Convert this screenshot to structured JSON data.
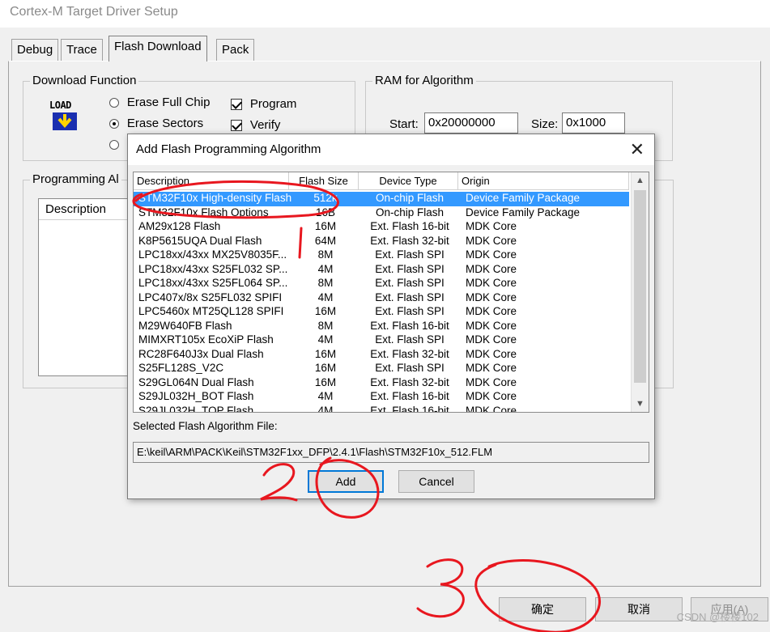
{
  "window": {
    "title": "Cortex-M Target Driver Setup"
  },
  "tabs": [
    {
      "label": "Debug",
      "active": false
    },
    {
      "label": "Trace",
      "active": false
    },
    {
      "label": "Flash Download",
      "active": true
    },
    {
      "label": "Pack",
      "active": false
    }
  ],
  "download_function": {
    "label": "Download Function",
    "icon_label": "LOAD",
    "radio_erase_full_chip": "Erase Full Chip",
    "radio_erase_sectors": "Erase Sectors",
    "check_program": "Program",
    "check_verify": "Verify"
  },
  "ram": {
    "label": "RAM for Algorithm",
    "start_label": "Start:",
    "start_value": "0x20000000",
    "size_label": "Size:",
    "size_value": "0x1000"
  },
  "programming": {
    "label": "Programming Al",
    "description_header": "Description"
  },
  "dialog": {
    "title": "Add Flash Programming Algorithm",
    "close_symbol": "✕",
    "columns": [
      "Description",
      "Flash Size",
      "Device Type",
      "Origin"
    ],
    "rows": [
      [
        "STM32F10x High-density Flash",
        "512k",
        "On-chip Flash",
        "Device Family Package"
      ],
      [
        "STM32F10x Flash Options",
        "16B",
        "On-chip Flash",
        "Device Family Package"
      ],
      [
        "AM29x128 Flash",
        "16M",
        "Ext. Flash 16-bit",
        "MDK Core"
      ],
      [
        "K8P5615UQA Dual Flash",
        "64M",
        "Ext. Flash 32-bit",
        "MDK Core"
      ],
      [
        "LPC18xx/43xx MX25V8035F...",
        "8M",
        "Ext. Flash SPI",
        "MDK Core"
      ],
      [
        "LPC18xx/43xx S25FL032 SP...",
        "4M",
        "Ext. Flash SPI",
        "MDK Core"
      ],
      [
        "LPC18xx/43xx S25FL064 SP...",
        "8M",
        "Ext. Flash SPI",
        "MDK Core"
      ],
      [
        "LPC407x/8x S25FL032 SPIFI",
        "4M",
        "Ext. Flash SPI",
        "MDK Core"
      ],
      [
        "LPC5460x MT25QL128 SPIFI",
        "16M",
        "Ext. Flash SPI",
        "MDK Core"
      ],
      [
        "M29W640FB Flash",
        "8M",
        "Ext. Flash 16-bit",
        "MDK Core"
      ],
      [
        "MIMXRT105x EcoXiP Flash",
        "4M",
        "Ext. Flash SPI",
        "MDK Core"
      ],
      [
        "RC28F640J3x Dual Flash",
        "16M",
        "Ext. Flash 32-bit",
        "MDK Core"
      ],
      [
        "S25FL128S_V2C",
        "16M",
        "Ext. Flash SPI",
        "MDK Core"
      ],
      [
        "S29GL064N Dual Flash",
        "16M",
        "Ext. Flash 32-bit",
        "MDK Core"
      ],
      [
        "S29JL032H_BOT Flash",
        "4M",
        "Ext. Flash 16-bit",
        "MDK Core"
      ],
      [
        "S29JL032H_TOP Flash",
        "4M",
        "Ext. Flash 16-bit",
        "MDK Core"
      ]
    ],
    "selected_label": "Selected Flash Algorithm File:",
    "selected_path": "E:\\keil\\ARM\\PACK\\Keil\\STM32F1xx_DFP\\2.4.1\\Flash\\STM32F10x_512.FLM",
    "add_button": "Add",
    "cancel_button": "Cancel"
  },
  "footer": {
    "ok_button": "确定",
    "cancel_button": "取消",
    "apply_button": "应用(A)"
  },
  "watermark": "CSDN @楼楼102",
  "annotations": {
    "step1": "1",
    "step2": "2",
    "step3": "3",
    "color": "#e8171f"
  }
}
